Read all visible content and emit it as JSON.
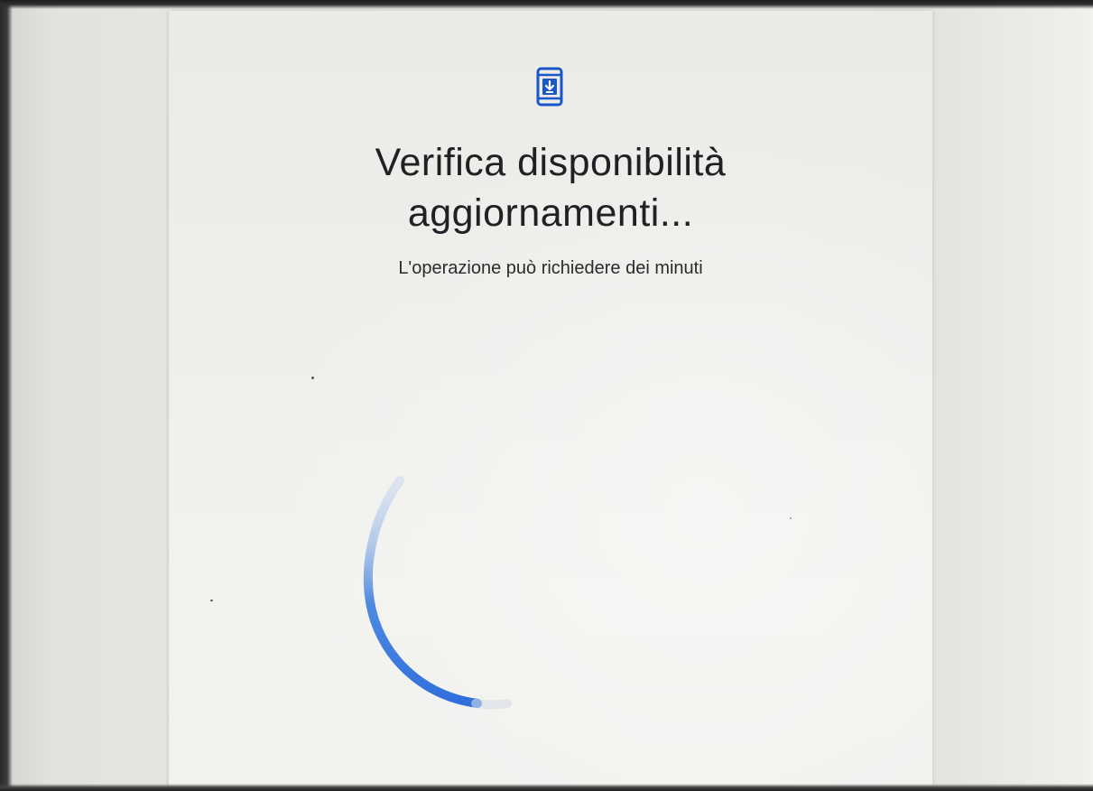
{
  "screen": {
    "title_line1": "Verifica disponibilità",
    "title_line2": "aggiornamenti...",
    "subtitle": "L'operazione può richiedere dei minuti"
  },
  "icons": {
    "header": "phone-download-icon",
    "progress": "loading-spinner"
  },
  "colors": {
    "accent": "#1a56c8",
    "spinner": "#3f7fe0",
    "text": "#202124"
  }
}
